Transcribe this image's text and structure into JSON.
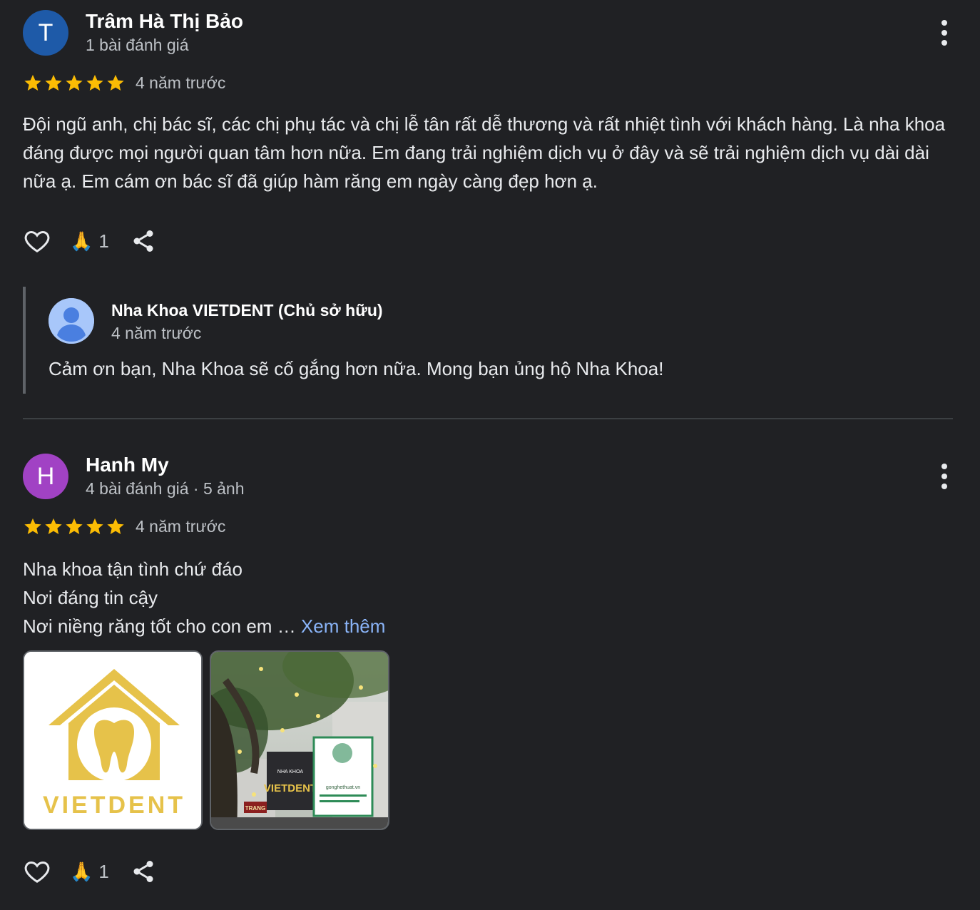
{
  "reviews": [
    {
      "avatar_letter": "T",
      "avatar_color": "#1e5aa8",
      "name": "Trâm Hà Thị Bảo",
      "meta": "1 bài đánh giá",
      "rating": 5,
      "time": "4 năm trước",
      "text": "Đội ngũ anh, chị bác sĩ, các chị phụ tác và chị lễ tân rất dễ thương và rất nhiệt tình với khách hàng. Là nha khoa đáng được mọi người quan tâm hơn nữa. Em đang trải nghiệm dịch vụ ở đây và sẽ trải nghiệm dịch vụ dài dài nữa ạ. Em cám ơn bác sĩ đã giúp hàm răng em ngày càng đẹp hơn ạ.",
      "reaction_emoji": "🙏",
      "reaction_count": "1",
      "owner_reply": {
        "name": "Nha Khoa VIETDENT (Chủ sở hữu)",
        "time": "4 năm trước",
        "text": "Cảm ơn bạn, Nha Khoa sẽ cố gắng hơn nữa. Mong bạn ủng hộ Nha Khoa!"
      }
    },
    {
      "avatar_letter": "H",
      "avatar_color": "#a142c4",
      "name": "Hanh My",
      "meta": "4 bài đánh giá · 5 ảnh",
      "rating": 5,
      "time": "4 năm trước",
      "text_lines": [
        "Nha khoa tận tình chứ đáo",
        "Nơi đáng tin cậy",
        "Nơi niềng răng tốt cho con em …"
      ],
      "see_more": "Xem thêm",
      "photos": {
        "logo_text": "VIETDENT",
        "sign_small": "NHA KHOA",
        "sign_brand": "VIETDENT",
        "sign_green_url": "gonghethuat.vn",
        "sign_left": "TRANG"
      },
      "reaction_emoji": "🙏",
      "reaction_count": "1"
    }
  ],
  "colors": {
    "background": "#202124",
    "star": "#fbbc04",
    "link": "#8ab4f8",
    "logo_gold": "#e6c24a"
  }
}
